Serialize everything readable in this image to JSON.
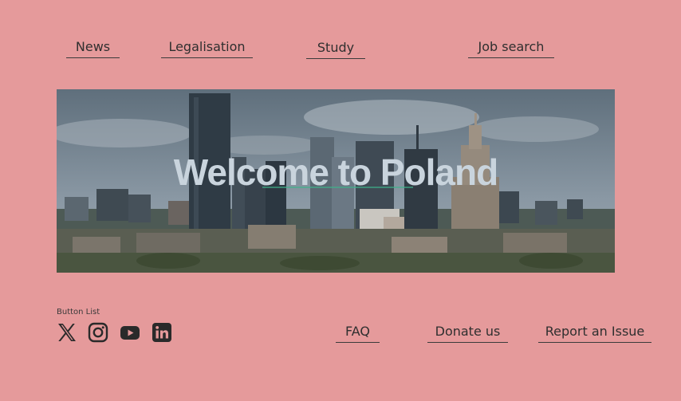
{
  "nav": {
    "items": [
      {
        "label": "News"
      },
      {
        "label": "Legalisation"
      },
      {
        "label": "Study"
      },
      {
        "label": "Job search"
      }
    ]
  },
  "hero": {
    "title": "Welcome to Poland"
  },
  "footer": {
    "button_list_label": "Button List",
    "social": [
      {
        "icon": "x-icon"
      },
      {
        "icon": "instagram-icon"
      },
      {
        "icon": "youtube-icon"
      },
      {
        "icon": "linkedin-icon"
      }
    ],
    "links": [
      {
        "label": "FAQ"
      },
      {
        "label": "Donate us"
      },
      {
        "label": "Report an Issue"
      }
    ]
  },
  "colors": {
    "background": "#e59a9b",
    "text": "#2f2f2f",
    "hero_title": "#c9d4dd"
  }
}
